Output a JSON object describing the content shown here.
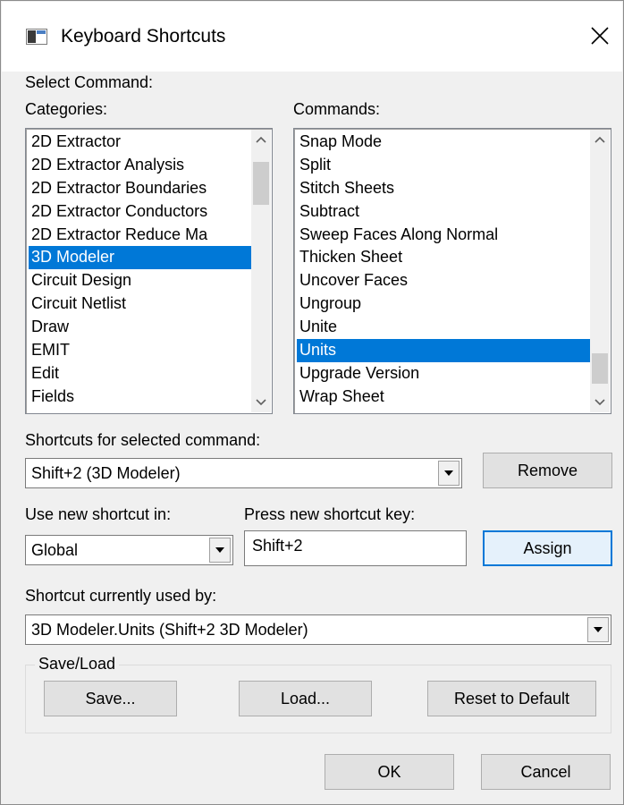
{
  "window": {
    "title": "Keyboard Shortcuts"
  },
  "select_command_label": "Select Command:",
  "categories": {
    "label": "Categories:",
    "items": [
      "2D Extractor",
      "2D Extractor Analysis",
      "2D Extractor Boundaries",
      "2D Extractor Conductors",
      "2D Extractor Reduce Ma",
      "3D Modeler",
      "Circuit Design",
      "Circuit Netlist",
      "Draw",
      "EMIT",
      "Edit",
      "Fields"
    ],
    "selected": "3D Modeler"
  },
  "commands": {
    "label": "Commands:",
    "items": [
      "Snap Mode",
      "Split",
      "Stitch Sheets",
      "Subtract",
      "Sweep Faces Along Normal",
      "Thicken Sheet",
      "Uncover Faces",
      "Ungroup",
      "Unite",
      "Units",
      "Upgrade Version",
      "Wrap Sheet"
    ],
    "selected": "Units"
  },
  "shortcuts": {
    "label": "Shortcuts for selected command:",
    "value": "Shift+2 (3D Modeler)",
    "remove_label": "Remove"
  },
  "use_in": {
    "label": "Use new shortcut in:",
    "value": "Global"
  },
  "new_key": {
    "label": "Press new shortcut key:",
    "value": "Shift+2",
    "assign_label": "Assign"
  },
  "currently_used": {
    "label": "Shortcut currently used by:",
    "value": "3D Modeler.Units (Shift+2 3D Modeler)"
  },
  "save_load": {
    "legend": "Save/Load",
    "save_label": "Save...",
    "load_label": "Load...",
    "reset_label": "Reset to Default"
  },
  "footer": {
    "ok_label": "OK",
    "cancel_label": "Cancel"
  },
  "colors": {
    "selection": "#0078d7",
    "dialog_bg": "#f0f0f0"
  }
}
